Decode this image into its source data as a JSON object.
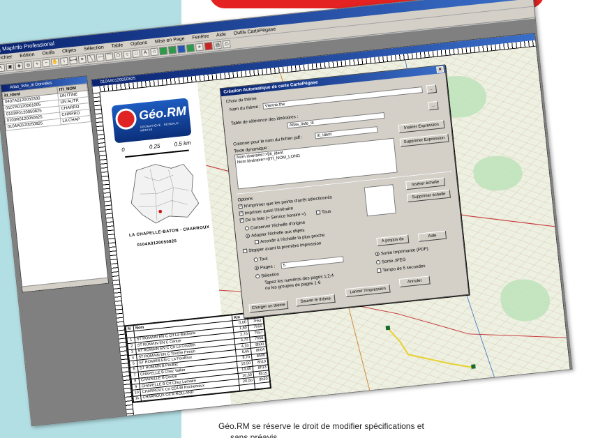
{
  "brand_colors": {
    "banner": "#e52222",
    "wedge": "#b2dfe4"
  },
  "app": {
    "title": "MapInfo Professional",
    "menu": [
      "Fichier",
      "Edition",
      "Outils",
      "Objets",
      "Sélection",
      "Table",
      "Options",
      "Mise en Page",
      "Fenêtre",
      "Aide",
      "Outils CartoPégase"
    ]
  },
  "data_window": {
    "title": "Atlas_liste_iti Données",
    "columns": [
      "iti_ident",
      "ITI_NOM"
    ],
    "rows": [
      [
        "0407A0120050330",
        "UN ITINE"
      ],
      [
        "0107A0120061005",
        "UN AUTR"
      ],
      [
        "0103R0120050825",
        "CHARRO"
      ],
      [
        "0103R0120050825",
        "CHARRO"
      ],
      [
        "0104A0120050825",
        "LA CHAP"
      ]
    ]
  },
  "layout_window": {
    "title": "0104A0120050825",
    "logo": {
      "name": "Géo.RM",
      "tag": "GEOMATIQUE · RESEAUX · MEDIAS"
    },
    "scale": {
      "zero": "0",
      "mid": "0.25",
      "max": "0.5 km"
    },
    "caption": "LA CHAPELLE-BATON - CHARROUX",
    "code": "0104A0120050825"
  },
  "itinerary_table": {
    "headers": [
      "N",
      "Nom",
      "Km",
      "heure"
    ],
    "rows": [
      [
        "",
        "",
        "0,00",
        "7h52"
      ],
      [
        "1",
        "ST ROMAIN EN C Crt La Bacherie",
        "1,60",
        "7h55"
      ],
      [
        "2",
        "ST ROMAIN EN C Centre",
        "2,70",
        "7h57"
      ],
      [
        "3",
        "ST ROMAIN EN C Crt Le Coudret",
        "3,70",
        "7h58"
      ],
      [
        "4",
        "ST ROMAIN EN C Touche Perion",
        "4,10",
        "8h00"
      ],
      [
        "5",
        "ST ROMAIN EN C La Fouilloux",
        "6,65",
        "8h04"
      ],
      [
        "6",
        "ST ROMAIN B Poullac",
        "8,70",
        "8h06"
      ],
      [
        "7",
        "CHAPELLE B Chez Vallier",
        "10,50",
        "8h10"
      ],
      [
        "8",
        "CHAPELLE B Centre",
        "13,40",
        "8h13"
      ],
      [
        "9",
        "CHAPELLE B Crt Chez Lemaire",
        "16,60",
        "8h15"
      ],
      [
        "10",
        "CHARROUX Crt CD148 Rochemaux",
        "20,00",
        "8h20"
      ],
      [
        "11",
        "CHARROUX Crt R.ROLLAND",
        "",
        ""
      ]
    ]
  },
  "dialog": {
    "title": "Création Automatique de carte CartoPégase",
    "theme_group": "Choix du thème",
    "theme_label": "Nom du thème :",
    "theme_value": "Vienne.the",
    "ref_table_label": "Table de référence des itinéraires :",
    "ref_table_value": "Atlas_liste_iti",
    "pdf_col_label": "Colonne pour le nom du fichier pdf :",
    "pdf_col_value": "iti_ident",
    "dyn_text_label": "Texte dynamique :",
    "dyn_text_lines": [
      "Nom itinéraire=>[Iti_ident",
      "Nom itinéraire=>[ITI_NOM_LONG"
    ],
    "btn_insert_expr": "Insérer Expression",
    "btn_delete_expr": "Supprimer Expression",
    "options_label": "Options",
    "opt_print_points": "N'imprimer que les points d'arrêt sélectionnés",
    "opt_print_itin": "Imprimer aussi l'itinéraire",
    "opt_from_list": "De la liste  (= Service horaire =)",
    "opt_all": "Tous",
    "opt_keep_scale": "Conserver l'échelle d'origine",
    "opt_adapt_scale": "Adapter l'échelle aux objets",
    "opt_round_scale": "Arrondir à l'échelle la plus proche",
    "opt_stop_first": "Stopper avant la première impression",
    "btn_insert_scale": "Insérer échelle",
    "btn_delete_scale": "Supprimer échelle",
    "pages_all": "Tout",
    "pages_label": "Pages :",
    "pages_value": "5",
    "pages_selection": "Sélection",
    "pages_hint1": "Tapez les numéros des pages 1;2;4",
    "pages_hint2": "ou les groupes de pages 1-6",
    "btn_about": "A propos de",
    "btn_help": "Aide",
    "out_pdf": "Sortie Imprimante (PDF)",
    "out_jpeg": "Sortie JPEG",
    "out_delay": "Tempo de 5 secondes",
    "btn_load_theme": "Charger un thème",
    "btn_save_theme": "Sauver le thème",
    "btn_launch": "Lancer l'impression",
    "btn_cancel": "Annuler"
  },
  "footer_line1": "Géo.RM se réserve le droit de modifier spécifications et",
  "footer_line2": "sans préavis."
}
